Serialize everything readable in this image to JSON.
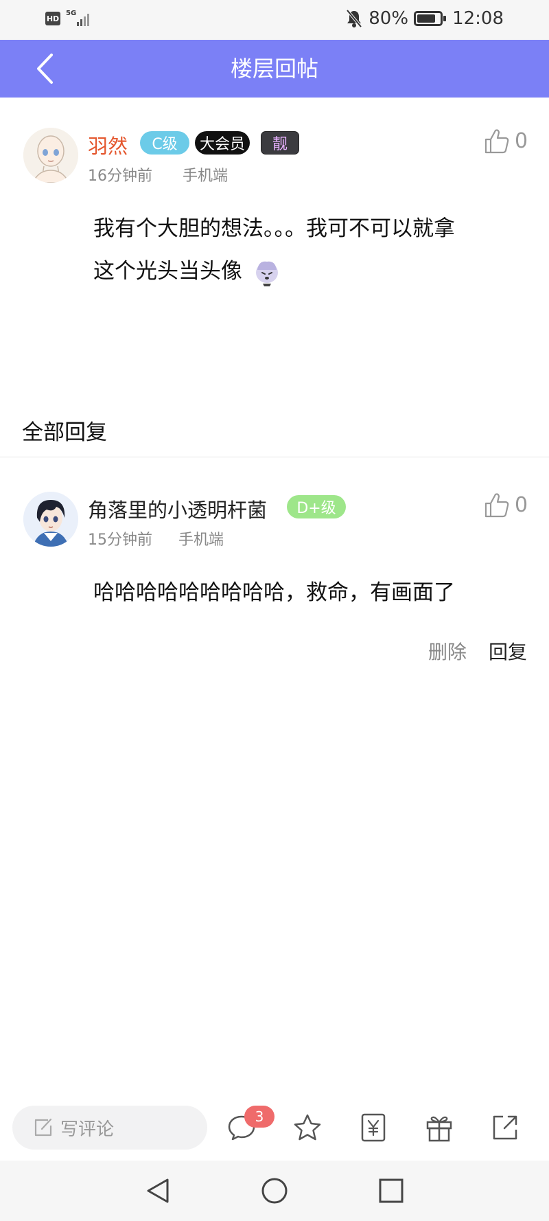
{
  "status_bar": {
    "hd": "HD",
    "network": "5G",
    "battery_percent": "80%",
    "battery_level": 0.8,
    "time": "12:08",
    "icons": [
      "hd-icon",
      "signal-icon",
      "mute-bell-icon",
      "battery-icon"
    ]
  },
  "header": {
    "title": "楼层回帖",
    "background": "#7b80f6"
  },
  "post": {
    "author": "羽然",
    "author_color": "#e4572e",
    "level_badge": "C级",
    "vip_badge": "大会员",
    "style_badge": "靓",
    "time": "16分钟前",
    "device": "手机端",
    "likes": "0",
    "content_line1": "我有个大胆的想法。。。我可不可以就拿",
    "content_line2": "这个光头当头像"
  },
  "replies_section": {
    "title": "全部回复"
  },
  "reply": {
    "author": "角落里的小透明杆菌",
    "level_badge": "D+级",
    "time": "15分钟前",
    "device": "手机端",
    "likes": "0",
    "content": "哈哈哈哈哈哈哈哈哈，救命，有画面了",
    "delete_label": "删除",
    "reply_label": "回复"
  },
  "bottom_bar": {
    "comment_placeholder": "写评论",
    "comment_count": "3",
    "icons": [
      "edit-icon",
      "comment-icon",
      "star-icon",
      "coin-icon",
      "gift-icon",
      "share-icon"
    ]
  },
  "nav_bar": {
    "icons": [
      "nav-back-icon",
      "nav-home-icon",
      "nav-recent-icon"
    ]
  }
}
